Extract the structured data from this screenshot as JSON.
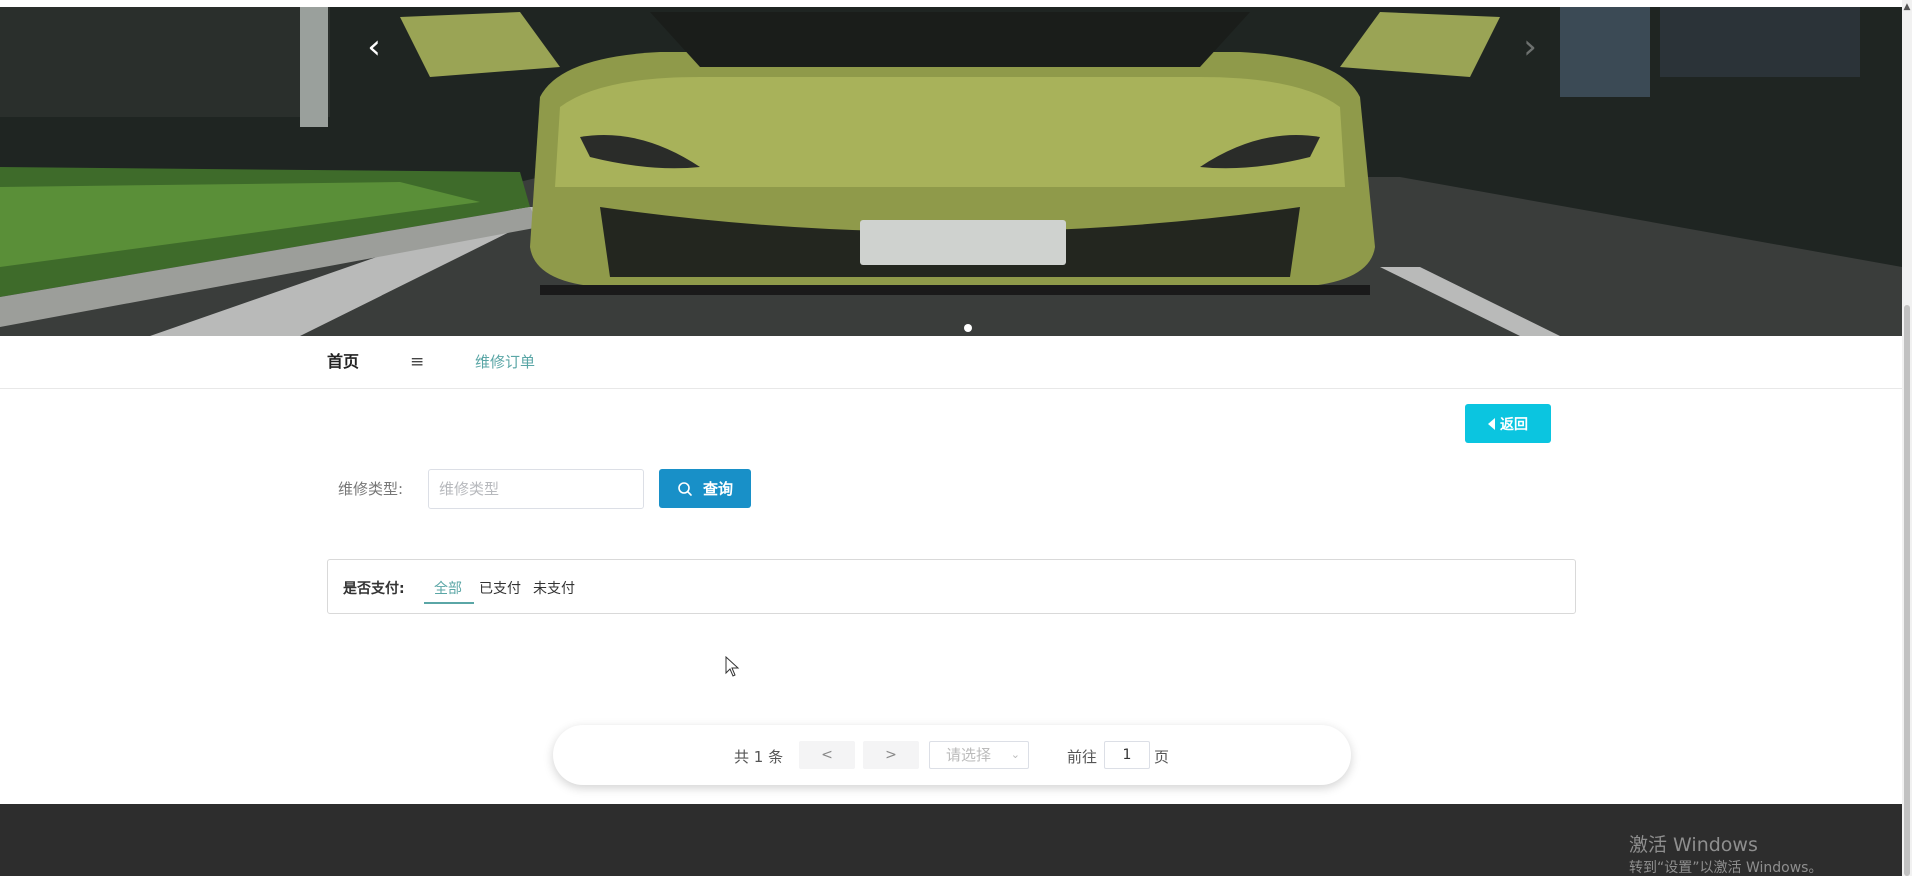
{
  "banner": {
    "prev_glyph": "‹",
    "next_glyph": "›"
  },
  "nav": {
    "home": "首页",
    "menu_glyph": "≡",
    "current": "维修订单"
  },
  "back_button": {
    "label": "返回"
  },
  "search": {
    "label": "维修类型:",
    "placeholder": "维修类型",
    "value": "",
    "button_label": "查询"
  },
  "filter": {
    "label": "是否支付:",
    "options": [
      "全部",
      "已支付",
      "未支付"
    ],
    "selected": "全部"
  },
  "pagination": {
    "total_text": "共 1 条",
    "prev": "<",
    "next": ">",
    "page_size_placeholder": "请选择",
    "goto_label": "前往",
    "goto_value": "1",
    "page_label": "页"
  },
  "watermark": {
    "title": "激活 Windows",
    "subtitle": "转到“设置”以激活 Windows。"
  },
  "colors": {
    "accent": "#5aa6a6",
    "back_button": "#0bc5e0",
    "query_button": "#1890c8",
    "footer": "#2d2d2d"
  }
}
